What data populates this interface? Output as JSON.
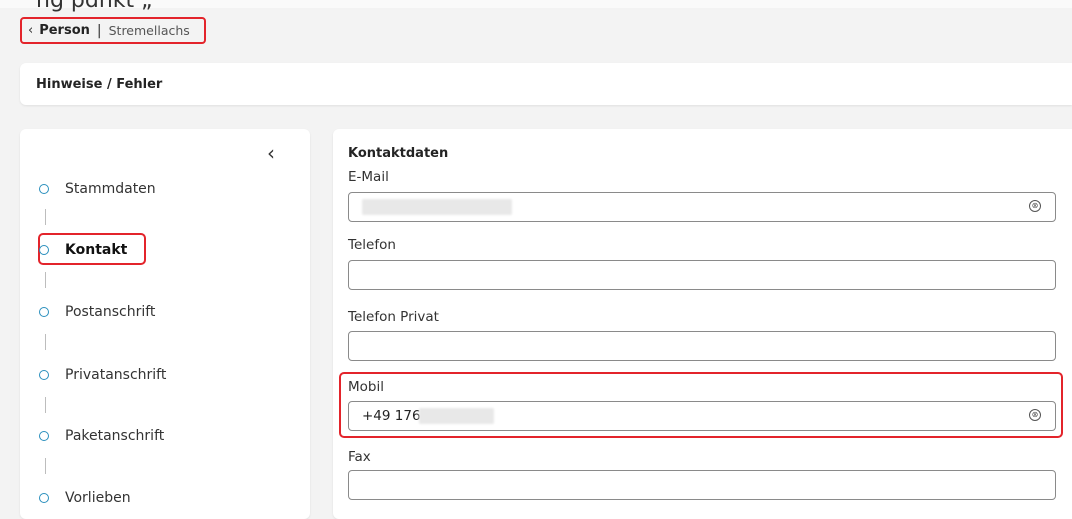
{
  "top_text": "ng pdnkt „",
  "breadcrumb": {
    "back_icon": "chevron-left-icon",
    "back": "‹",
    "person": "Person",
    "separator": "|",
    "name": "Stremellachs"
  },
  "hints": {
    "title": "Hinweise / Fehler"
  },
  "nav": {
    "collapse": "‹",
    "steps": [
      {
        "label": "Stammdaten"
      },
      {
        "label": "Kontakt"
      },
      {
        "label": "Postanschrift"
      },
      {
        "label": "Privatanschrift"
      },
      {
        "label": "Paketanschrift"
      },
      {
        "label": "Vorlieben"
      }
    ],
    "active_step": "Kontakt"
  },
  "main": {
    "section_title": "Kontaktdaten",
    "fields": [
      {
        "label": "E-Mail",
        "value": "",
        "has_clear": true,
        "blurred": true
      },
      {
        "label": "Telefon",
        "value": ""
      },
      {
        "label": "Telefon Privat",
        "value": ""
      },
      {
        "label": "Mobil",
        "value": "+49 176",
        "has_clear": true,
        "blurred": true
      },
      {
        "label": "Fax",
        "value": ""
      }
    ],
    "clear_icon": "⊗"
  },
  "colors": {
    "highlight": "#e3242b",
    "step_circle": "#2a8fbd",
    "background": "#f3f3f3"
  }
}
